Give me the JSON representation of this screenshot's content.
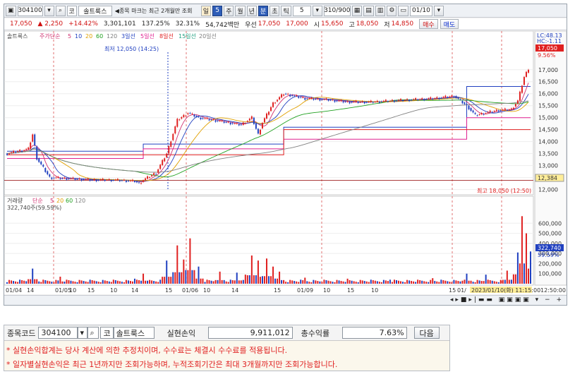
{
  "toolbar": {
    "code": "304100",
    "market": "코",
    "stock_name": "솔트룩스",
    "msg": "◀종목 마크는 최근 2개월만 조회",
    "periods": [
      "일",
      "5",
      "주",
      "월",
      "년",
      "분",
      "초",
      "틱"
    ],
    "selected_period": "분",
    "interval": "5",
    "count": "310/900",
    "date": "01/10"
  },
  "quote": {
    "price": "17,050",
    "change": "▲ 2,250",
    "pct": "+14.42%",
    "volume": "3,301,101",
    "vol_ratio": "137.25%",
    "turnover": "32.31%",
    "amount": "54,742백만",
    "pref_label": "우선",
    "pref": "17,050",
    "ask": "17,000",
    "open_label": "시",
    "open": "15,650",
    "high_label": "고",
    "high": "18,050",
    "low_label": "저",
    "low": "14,850",
    "buy": "매수",
    "sell": "매도"
  },
  "legend": {
    "name": "솔트룩스",
    "ma_title": "주가단순",
    "ma_periods": [
      "5",
      "10",
      "20",
      "60",
      "120"
    ],
    "bands": [
      "3일선",
      "5일선",
      "8일선",
      "15일선",
      "20일선"
    ],
    "min_label": "최저 12,050 (14:25)",
    "max_label": "최고 18,050 (12:50)",
    "lc": "LC:48.13",
    "hc": "HC:-1.11",
    "cur_price": "17,050",
    "cur_pct": "9.56%",
    "ref_price": "12,384"
  },
  "vol_legend": {
    "title": "거래량",
    "ma_title": "단순",
    "ma_periods": [
      "5",
      "20",
      "60",
      "120"
    ],
    "value": "322,740주(59.59%)",
    "cur": "322,740",
    "cur_pct": "59.59%"
  },
  "chart_data": {
    "type": "candlestick",
    "y_ticks": [
      "17,000",
      "16,500",
      "16,000",
      "15,500",
      "15,000",
      "14,500",
      "14,000",
      "13,500",
      "13,000",
      "12,500",
      "12,000"
    ],
    "y_min": 11900,
    "y_max": 18200,
    "price_path": [
      [
        0,
        13500
      ],
      [
        5,
        13600
      ],
      [
        10,
        13700
      ],
      [
        12,
        14300
      ],
      [
        14,
        13300
      ],
      [
        20,
        12500
      ],
      [
        30,
        12450
      ],
      [
        40,
        12400
      ],
      [
        50,
        12400
      ],
      [
        60,
        12350
      ],
      [
        62,
        12250
      ],
      [
        64,
        12400
      ],
      [
        70,
        12700
      ],
      [
        75,
        13500
      ],
      [
        80,
        14900
      ],
      [
        85,
        15200
      ],
      [
        90,
        15000
      ],
      [
        100,
        14850
      ],
      [
        110,
        14700
      ],
      [
        115,
        15000
      ],
      [
        118,
        14300
      ],
      [
        120,
        14800
      ],
      [
        125,
        15600
      ],
      [
        130,
        16000
      ],
      [
        140,
        15800
      ],
      [
        150,
        15750
      ],
      [
        160,
        15650
      ],
      [
        170,
        15650
      ],
      [
        180,
        15700
      ],
      [
        190,
        15750
      ],
      [
        200,
        15800
      ],
      [
        210,
        15900
      ],
      [
        216,
        15500
      ],
      [
        220,
        15100
      ],
      [
        225,
        15200
      ],
      [
        230,
        15300
      ],
      [
        237,
        15350
      ],
      [
        240,
        15700
      ],
      [
        243,
        16700
      ],
      [
        245,
        17050
      ]
    ],
    "vol_ticks": [
      "600,000",
      "500,000",
      "400,000",
      "300,000",
      "200,000",
      "100,000"
    ],
    "vol_max": 700000,
    "volumes": [
      [
        12,
        150000
      ],
      [
        25,
        70000
      ],
      [
        60,
        50000
      ],
      [
        64,
        100000
      ],
      [
        75,
        230000
      ],
      [
        80,
        380000
      ],
      [
        83,
        240000
      ],
      [
        86,
        450000
      ],
      [
        90,
        170000
      ],
      [
        100,
        120000
      ],
      [
        108,
        110000
      ],
      [
        112,
        90000
      ],
      [
        115,
        280000
      ],
      [
        118,
        230000
      ],
      [
        122,
        250000
      ],
      [
        125,
        170000
      ],
      [
        128,
        120000
      ],
      [
        140,
        60000
      ],
      [
        160,
        50000
      ],
      [
        180,
        40000
      ],
      [
        200,
        55000
      ],
      [
        216,
        100000
      ],
      [
        225,
        90000
      ],
      [
        235,
        130000
      ],
      [
        240,
        310000
      ],
      [
        242,
        670000
      ],
      [
        244,
        500000
      ],
      [
        246,
        320000
      ]
    ],
    "x_labels": [
      "01/04",
      "14",
      "01/05",
      "10",
      "15",
      "10",
      "14",
      "15",
      "01/06",
      "10",
      "14",
      "15",
      "01/09",
      "10",
      "15",
      "10",
      "15",
      "01/",
      "2023/01/10(화) 11:15:00",
      "12:50:00"
    ]
  },
  "panel": {
    "code_label": "종목코드",
    "code": "304100",
    "market": "코",
    "name": "솔트룩스",
    "profit_label": "실현손익",
    "profit": "9,911,012",
    "rate_label": "총수익률",
    "rate": "7.63%",
    "next": "다음",
    "note1": "* 실현손익합계는 당사 계산에 의한 추정치이며, 수수료는 체결시 수수료를 적용됩니다.",
    "note2": "* 일자별실현손익은 최근 1년까지만 조회가능하며, 누적조회기간은 최대 3개월까지만 조회가능합니다."
  }
}
